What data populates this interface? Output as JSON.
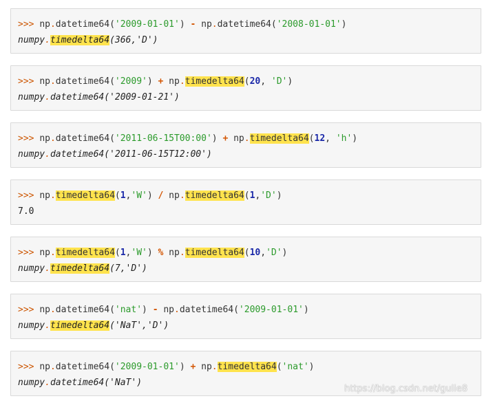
{
  "blocks": [
    {
      "input": [
        {
          "t": ">>> ",
          "c": "prompt"
        },
        {
          "t": "np"
        },
        {
          "t": ".",
          "c": "dot"
        },
        {
          "t": "datetime64("
        },
        {
          "t": "'2009-01-01'",
          "c": "str"
        },
        {
          "t": ") "
        },
        {
          "t": "-",
          "c": "op"
        },
        {
          "t": " np"
        },
        {
          "t": ".",
          "c": "dot"
        },
        {
          "t": "datetime64("
        },
        {
          "t": "'2008-01-01'",
          "c": "str"
        },
        {
          "t": ")"
        }
      ],
      "output": [
        {
          "t": "numpy"
        },
        {
          "t": ".",
          "c": "dot"
        },
        {
          "t": "timedelta64",
          "c": "hl"
        },
        {
          "t": "(366,'D')"
        }
      ]
    },
    {
      "input": [
        {
          "t": ">>> ",
          "c": "prompt"
        },
        {
          "t": "np"
        },
        {
          "t": ".",
          "c": "dot"
        },
        {
          "t": "datetime64("
        },
        {
          "t": "'2009'",
          "c": "str"
        },
        {
          "t": ") "
        },
        {
          "t": "+",
          "c": "op"
        },
        {
          "t": " np"
        },
        {
          "t": ".",
          "c": "dot"
        },
        {
          "t": "timedelta64",
          "c": "hl"
        },
        {
          "t": "("
        },
        {
          "t": "20",
          "c": "num"
        },
        {
          "t": ", "
        },
        {
          "t": "'D'",
          "c": "str"
        },
        {
          "t": ")"
        }
      ],
      "output": [
        {
          "t": "numpy"
        },
        {
          "t": ".",
          "c": "dot"
        },
        {
          "t": "datetime64('2009-01-21')"
        }
      ]
    },
    {
      "input": [
        {
          "t": ">>> ",
          "c": "prompt"
        },
        {
          "t": "np"
        },
        {
          "t": ".",
          "c": "dot"
        },
        {
          "t": "datetime64("
        },
        {
          "t": "'2011-06-15T00:00'",
          "c": "str"
        },
        {
          "t": ") "
        },
        {
          "t": "+",
          "c": "op"
        },
        {
          "t": " np"
        },
        {
          "t": ".",
          "c": "dot"
        },
        {
          "t": "timedelta64",
          "c": "hl"
        },
        {
          "t": "("
        },
        {
          "t": "12",
          "c": "num"
        },
        {
          "t": ", "
        },
        {
          "t": "'h'",
          "c": "str"
        },
        {
          "t": ")"
        }
      ],
      "output": [
        {
          "t": "numpy"
        },
        {
          "t": ".",
          "c": "dot"
        },
        {
          "t": "datetime64('2011-06-15T12:00')"
        }
      ]
    },
    {
      "input": [
        {
          "t": ">>> ",
          "c": "prompt"
        },
        {
          "t": "np"
        },
        {
          "t": ".",
          "c": "dot"
        },
        {
          "t": "timedelta64",
          "c": "hl"
        },
        {
          "t": "("
        },
        {
          "t": "1",
          "c": "num"
        },
        {
          "t": ","
        },
        {
          "t": "'W'",
          "c": "str"
        },
        {
          "t": ") "
        },
        {
          "t": "/",
          "c": "op"
        },
        {
          "t": " np"
        },
        {
          "t": ".",
          "c": "dot"
        },
        {
          "t": "timedelta64",
          "c": "hl"
        },
        {
          "t": "("
        },
        {
          "t": "1",
          "c": "num"
        },
        {
          "t": ","
        },
        {
          "t": "'D'",
          "c": "str"
        },
        {
          "t": ")"
        }
      ],
      "output": [
        {
          "t": "7.0"
        }
      ],
      "output_plain": true
    },
    {
      "input": [
        {
          "t": ">>> ",
          "c": "prompt"
        },
        {
          "t": "np"
        },
        {
          "t": ".",
          "c": "dot"
        },
        {
          "t": "timedelta64",
          "c": "hl"
        },
        {
          "t": "("
        },
        {
          "t": "1",
          "c": "num"
        },
        {
          "t": ","
        },
        {
          "t": "'W'",
          "c": "str"
        },
        {
          "t": ") "
        },
        {
          "t": "%",
          "c": "op"
        },
        {
          "t": " np"
        },
        {
          "t": ".",
          "c": "dot"
        },
        {
          "t": "timedelta64",
          "c": "hl"
        },
        {
          "t": "("
        },
        {
          "t": "10",
          "c": "num"
        },
        {
          "t": ","
        },
        {
          "t": "'D'",
          "c": "str"
        },
        {
          "t": ")"
        }
      ],
      "output": [
        {
          "t": "numpy"
        },
        {
          "t": ".",
          "c": "dot"
        },
        {
          "t": "timedelta64",
          "c": "hl"
        },
        {
          "t": "(7,'D')"
        }
      ]
    },
    {
      "input": [
        {
          "t": ">>> ",
          "c": "prompt"
        },
        {
          "t": "np"
        },
        {
          "t": ".",
          "c": "dot"
        },
        {
          "t": "datetime64("
        },
        {
          "t": "'nat'",
          "c": "str"
        },
        {
          "t": ") "
        },
        {
          "t": "-",
          "c": "op"
        },
        {
          "t": " np"
        },
        {
          "t": ".",
          "c": "dot"
        },
        {
          "t": "datetime64("
        },
        {
          "t": "'2009-01-01'",
          "c": "str"
        },
        {
          "t": ")"
        }
      ],
      "output": [
        {
          "t": "numpy"
        },
        {
          "t": ".",
          "c": "dot"
        },
        {
          "t": "timedelta64",
          "c": "hl"
        },
        {
          "t": "('NaT','D')"
        }
      ]
    },
    {
      "input": [
        {
          "t": ">>> ",
          "c": "prompt"
        },
        {
          "t": "np"
        },
        {
          "t": ".",
          "c": "dot"
        },
        {
          "t": "datetime64("
        },
        {
          "t": "'2009-01-01'",
          "c": "str"
        },
        {
          "t": ") "
        },
        {
          "t": "+",
          "c": "op"
        },
        {
          "t": " np"
        },
        {
          "t": ".",
          "c": "dot"
        },
        {
          "t": "timedelta64",
          "c": "hl"
        },
        {
          "t": "("
        },
        {
          "t": "'nat'",
          "c": "str"
        },
        {
          "t": ")"
        }
      ],
      "output": [
        {
          "t": "numpy"
        },
        {
          "t": ".",
          "c": "dot"
        },
        {
          "t": "datetime64('NaT')"
        }
      ]
    }
  ],
  "watermark": "https://blog.csdn.net/gulie8"
}
